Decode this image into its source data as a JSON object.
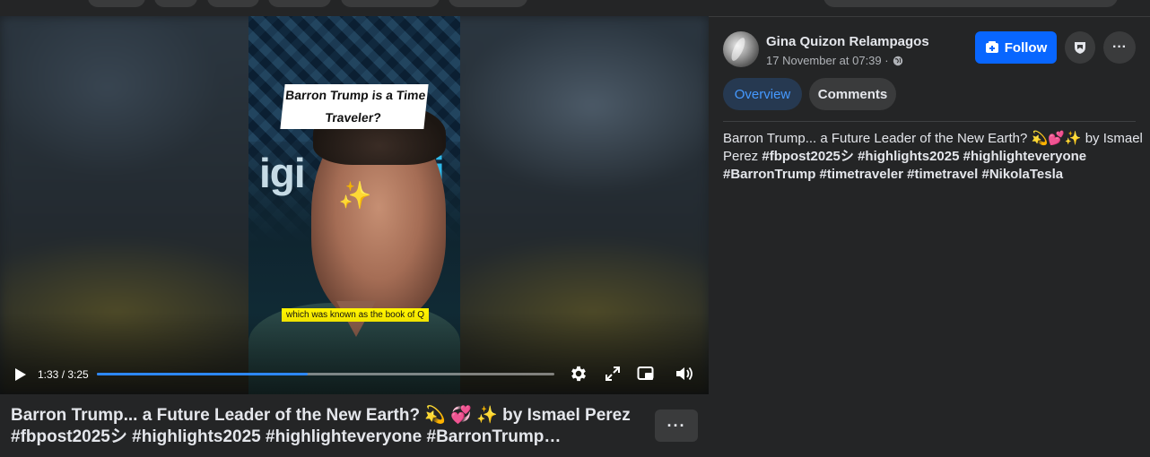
{
  "video": {
    "clip_caption_line1": "Barron Trump is a Time",
    "clip_caption_line2": "Traveler?",
    "clip_subtitle": "which was known as the book of Q",
    "sparkle_glyph": "✨",
    "controls": {
      "time": "1:33 / 3:25",
      "progress_fraction": 0.46
    }
  },
  "post": {
    "title": "Barron Trump... a Future Leader of the New Earth? 💫 💞 ✨ by Ismael Perez #fbpost2025シ #highlights2025 #highlighteveryone #BarronTrump #timetraveler #timetravel #NikolaTesla",
    "more_label": "···"
  },
  "author": {
    "name": "Gina Quizon Relampagos",
    "timestamp": "17 November at 07:39 ·",
    "privacy_icon": "globe-icon"
  },
  "actions": {
    "follow_label": "Follow",
    "more_label": "···"
  },
  "tabs": [
    {
      "label": "Overview",
      "active": true
    },
    {
      "label": "Comments",
      "active": false
    }
  ],
  "description": {
    "text": "Barron Trump... a Future Leader of the New Earth? 💫💕✨ by Ismael Perez ",
    "hashtags": [
      "#fbpost2025シ",
      "#highlights2025",
      "#highlighteveryone",
      "#BarronTrump",
      "#timetraveler",
      "#timetravel",
      "#NikolaTesla"
    ]
  },
  "colors": {
    "accent": "#0866ff",
    "progress": "#2d88ff",
    "background": "#242526",
    "tab_active_bg": "#263951",
    "tab_active_text": "#4599ff"
  }
}
